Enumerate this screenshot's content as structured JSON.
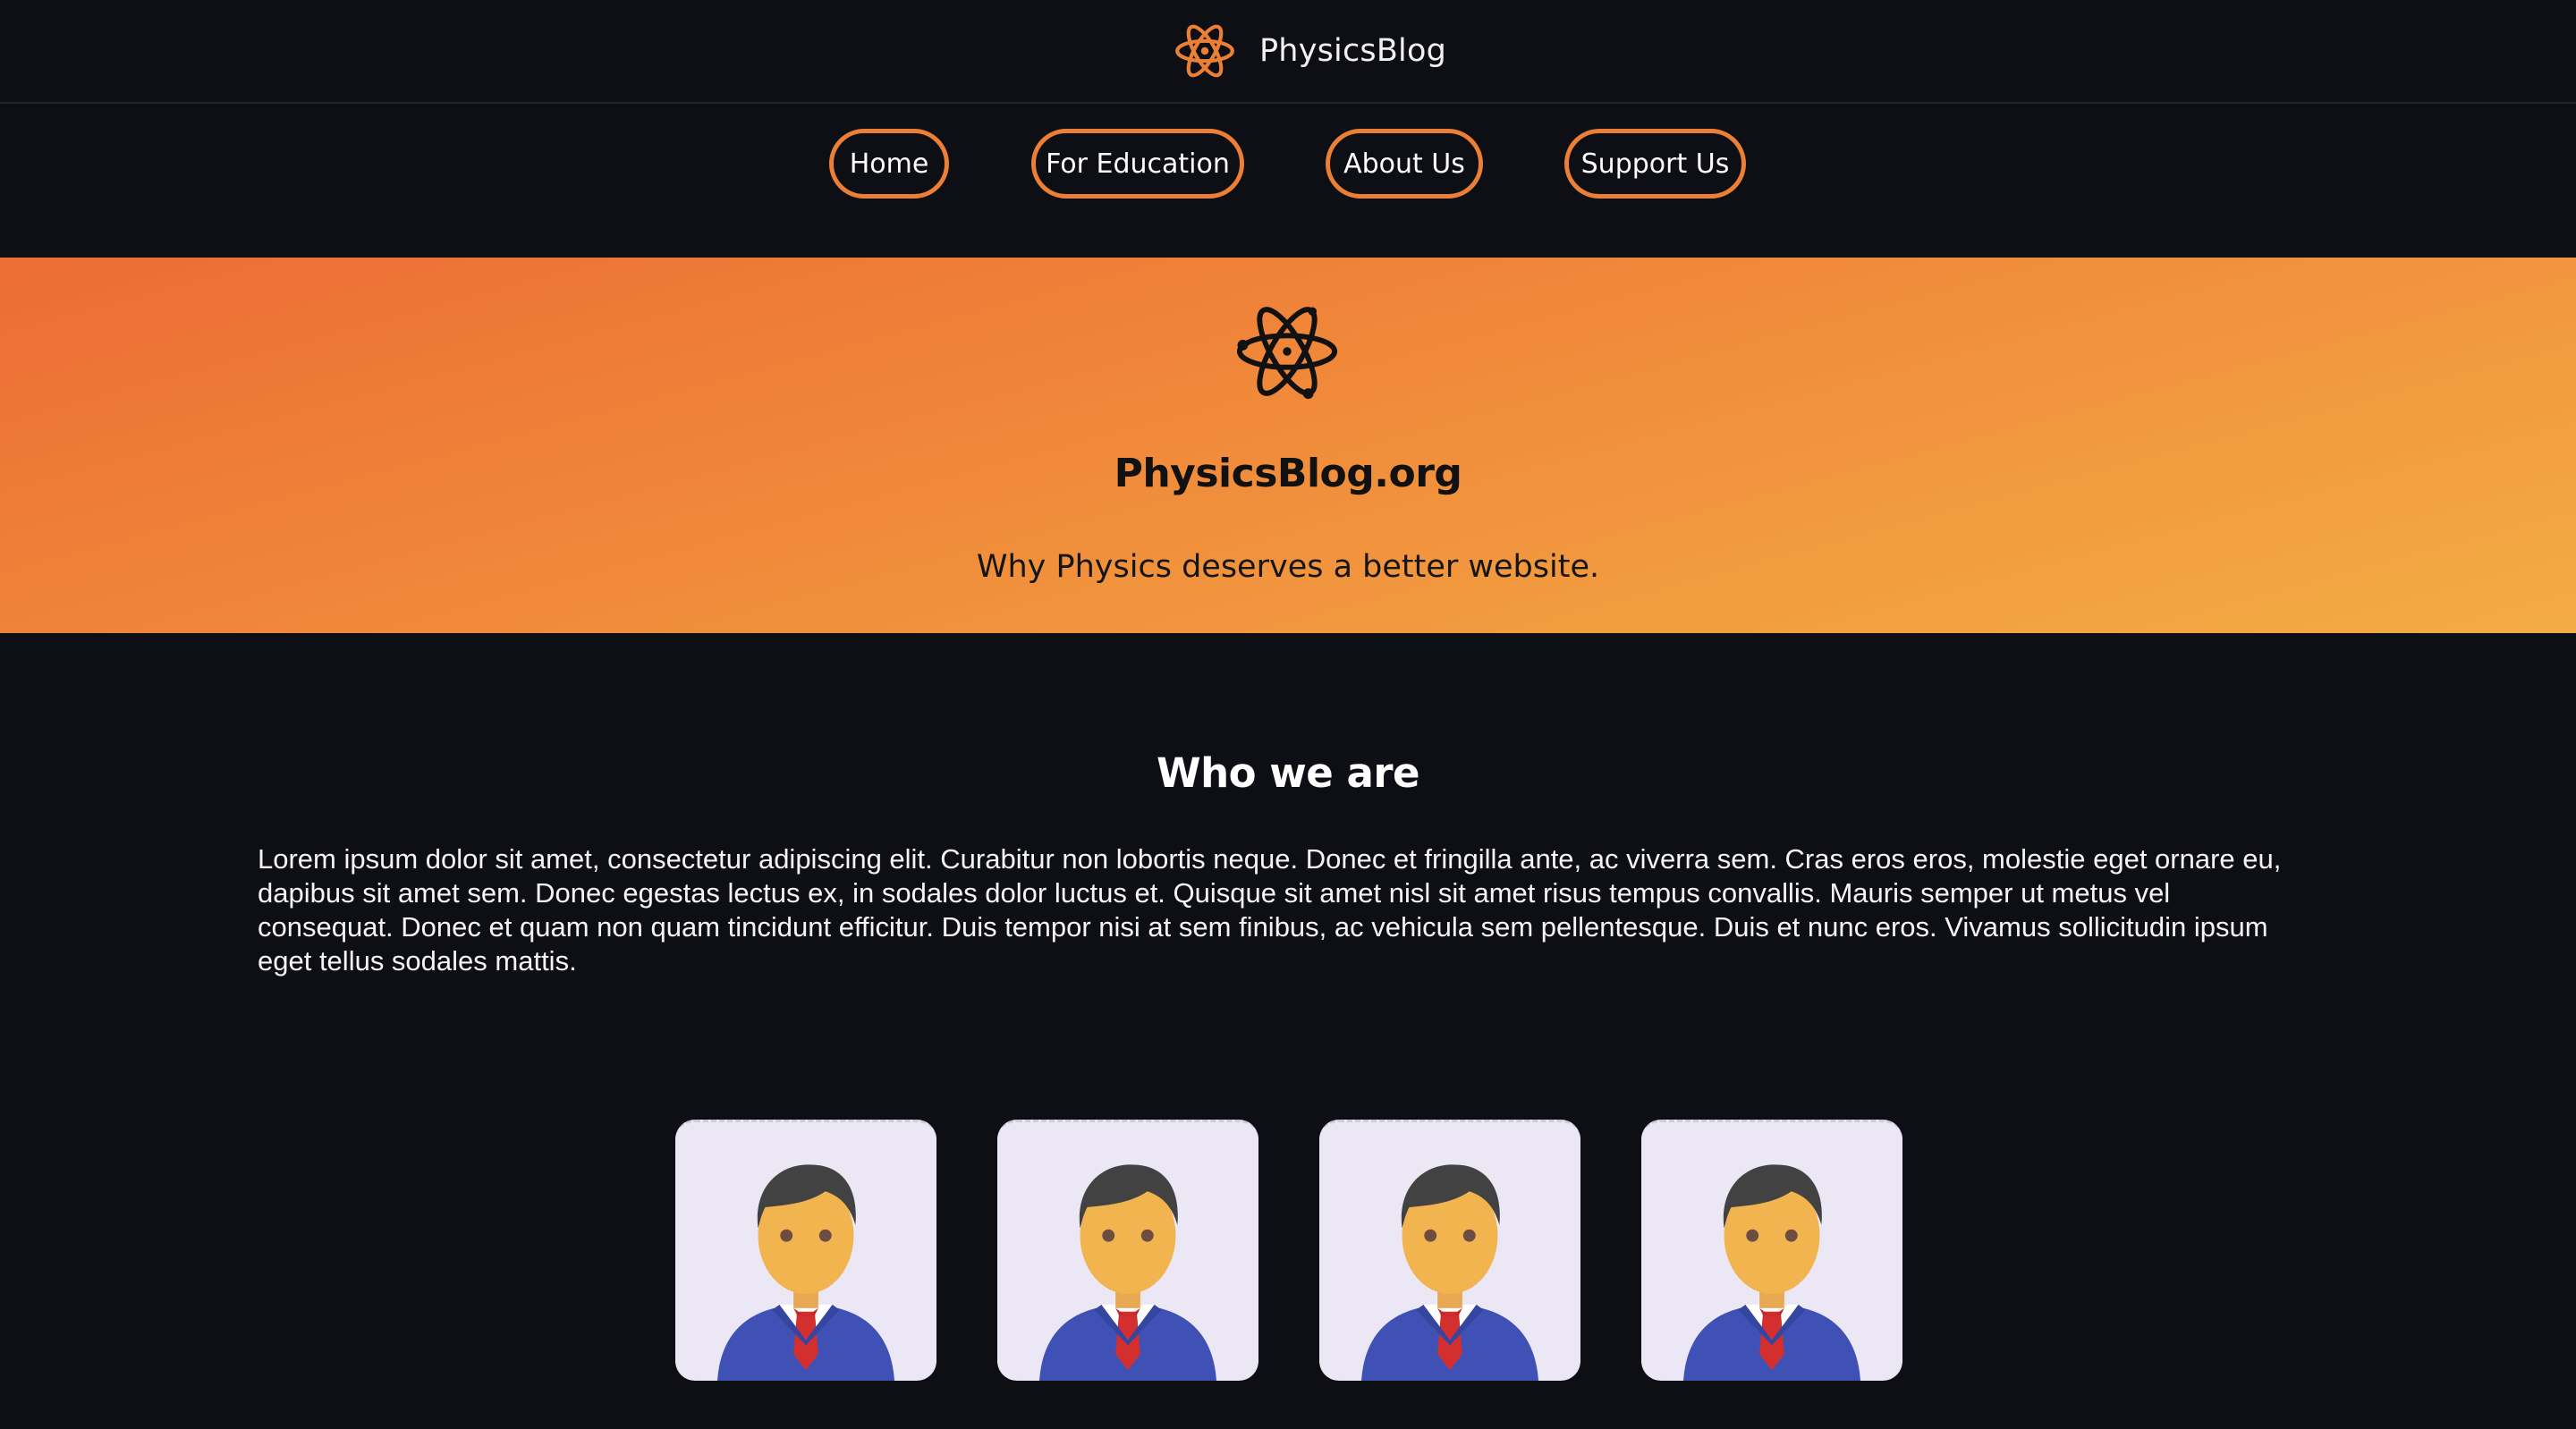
{
  "header": {
    "brand_name": "PhysicsBlog",
    "logo_icon": "atom-icon"
  },
  "nav": {
    "items": [
      {
        "label": "Home"
      },
      {
        "label": "For Education"
      },
      {
        "label": "About Us"
      },
      {
        "label": "Support Us"
      }
    ]
  },
  "hero": {
    "logo_icon": "atom-icon",
    "title": "PhysicsBlog.org",
    "subtitle": "Why Physics deserves a better website."
  },
  "about": {
    "title": "Who we are",
    "body": "Lorem ipsum dolor sit amet, consectetur adipiscing elit. Curabitur non lobortis neque. Donec et fringilla ante, ac viverra sem. Cras eros eros, molestie eget ornare eu, dapibus sit amet sem. Donec egestas lectus ex, in sodales dolor luctus et. Quisque sit amet nisl sit amet risus tempus convallis. Mauris semper ut metus vel consequat. Donec et quam non quam tincidunt efficitur. Duis tempor nisi at sem finibus, ac vehicula sem pellentesque. Duis et nunc eros. Vivamus sollicitudin ipsum eget tellus sodales mattis."
  },
  "team": {
    "members": [
      {
        "avatar_icon": "person-avatar-icon"
      },
      {
        "avatar_icon": "person-avatar-icon"
      },
      {
        "avatar_icon": "person-avatar-icon"
      },
      {
        "avatar_icon": "person-avatar-icon"
      }
    ]
  },
  "colors": {
    "background": "#0e0e15",
    "accent": "#ea7f35",
    "hero_gradient_start": "#ec6d35",
    "hero_gradient_end": "#f3ac44",
    "card_background": "#ebe7f4"
  }
}
